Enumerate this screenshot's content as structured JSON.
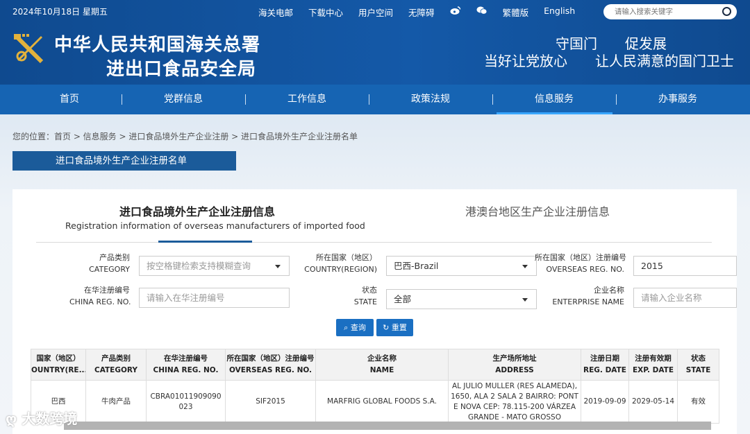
{
  "topbar": {
    "date": "2024年10月18日 星期五",
    "links": [
      "海关电邮",
      "下载中心",
      "用户空间",
      "无障碍"
    ],
    "icons": [
      "weibo-icon",
      "wechat-icon"
    ],
    "lang_links": [
      "繁體版",
      "English"
    ],
    "search_placeholder": "请输入搜索关键字"
  },
  "header": {
    "title_line1": "中华人民共和国海关总署",
    "title_line2": "进出口食品安全局",
    "slogan_line1": "守国门　　促发展",
    "slogan_line2": "当好让党放心　　让人民满意的国门卫士"
  },
  "nav": {
    "items": [
      "首页",
      "党群信息",
      "工作信息",
      "政策法规",
      "信息服务",
      "办事服务"
    ],
    "active": "信息服务"
  },
  "breadcrumb": "您的位置：首页 > 信息服务 > 进口食品境外生产企业注册 > 进口食品境外生产企业注册名单",
  "section_title": "进口食品境外生产企业注册名单",
  "tabs": {
    "active_cn": "进口食品境外生产企业注册信息",
    "active_en": "Registration information of overseas manufacturers of imported food",
    "other_cn": "港澳台地区生产企业注册信息"
  },
  "form": {
    "category": {
      "label_cn": "产品类别",
      "label_en": "CATEGORY",
      "placeholder": "按空格键检索支持模糊查询"
    },
    "country": {
      "label_cn": "所在国家（地区）",
      "label_en": "COUNTRY(REGION)",
      "value": "巴西-Brazil"
    },
    "overseas_reg": {
      "label_cn": "所在国家（地区）注册编号",
      "label_en": "OVERSEAS REG. NO.",
      "value": "2015"
    },
    "china_reg": {
      "label_cn": "在华注册编号",
      "label_en": "CHINA REG. NO.",
      "placeholder": "请输入在华注册编号"
    },
    "state": {
      "label_cn": "状态",
      "label_en": "STATE",
      "value": "全部"
    },
    "enterprise": {
      "label_cn": "企业名称",
      "label_en": "ENTERPRISE NAME",
      "placeholder": "请输入企业名称"
    },
    "search_button": "查询",
    "reset_button": "重置"
  },
  "table": {
    "headers": [
      {
        "cn": "国家（地区）",
        "en": "OUNTRY(RE..."
      },
      {
        "cn": "产品类别",
        "en": "CATEGORY"
      },
      {
        "cn": "在华注册编号",
        "en": "CHINA REG. NO."
      },
      {
        "cn": "所在国家（地区）注册编号",
        "en": "OVERSEAS REG. NO."
      },
      {
        "cn": "企业名称",
        "en": "NAME"
      },
      {
        "cn": "生产场所地址",
        "en": "ADDRESS"
      },
      {
        "cn": "注册日期",
        "en": "REG. DATE"
      },
      {
        "cn": "注册有效期",
        "en": "EXP. DATE"
      },
      {
        "cn": "状态",
        "en": "STATE"
      }
    ],
    "rows": [
      [
        "巴西",
        "牛肉产品",
        "CBRA01011909090023",
        "SIF2015",
        "MARFRIG GLOBAL FOODS S.A.",
        "AL JULIO MULLER (RES ALAMEDA), 1650, ALA 2 SALA 2 BAIRRO: PONTE NOVA CEP: 78.115-200 VÁRZEA GRANDE - MATO GROSSO",
        "2019-09-09",
        "2029-05-14",
        "有效"
      ]
    ]
  },
  "watermark": "大数跨境"
}
